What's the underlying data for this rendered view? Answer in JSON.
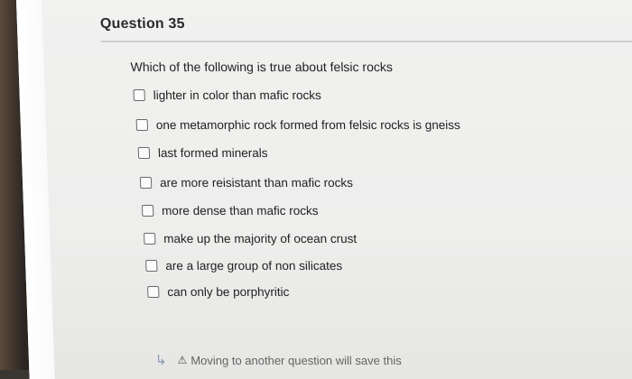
{
  "question": {
    "title": "Question 35",
    "prompt": "Which of the following is true about felsic rocks",
    "options": [
      "lighter in color than mafic rocks",
      "one metamorphic rock formed from felsic rocks is gneiss",
      "last formed minerals",
      "are more reisistant than mafic rocks",
      "more dense than mafic rocks",
      "make up the majority of ocean crust",
      "are a large group of non silicates",
      "can only be porphyritic"
    ]
  },
  "footer": {
    "arrow_icon": "return-arrow-icon",
    "warning_icon": "warning-icon",
    "text": "Moving to another question will save this"
  }
}
